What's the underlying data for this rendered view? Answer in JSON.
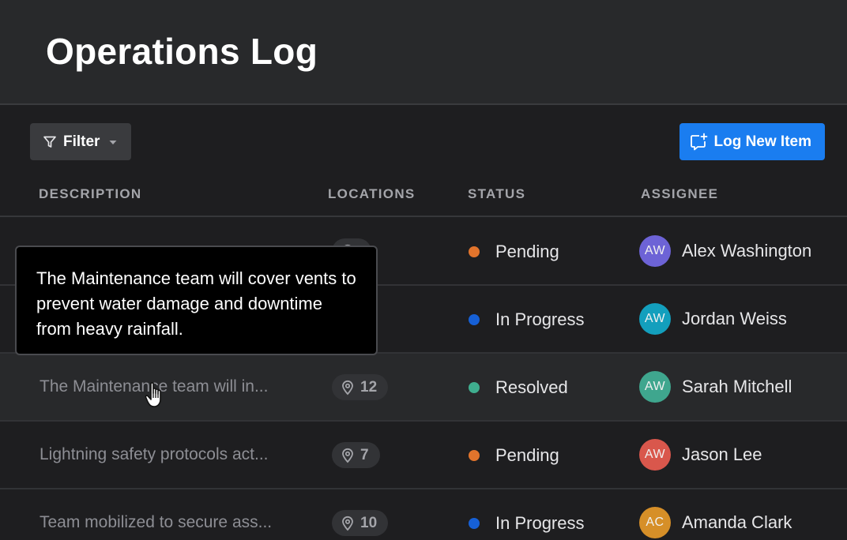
{
  "header": {
    "title": "Operations Log"
  },
  "toolbar": {
    "filter_label": "Filter",
    "log_button_label": "Log New Item"
  },
  "colors": {
    "accent": "#1a7df0",
    "pending": "#e2742c",
    "in_progress": "#1660d6",
    "resolved": "#3fae8f"
  },
  "table": {
    "columns": [
      "DESCRIPTION",
      "LOCATIONS",
      "STATUS",
      "ASSIGNEE"
    ],
    "rows": [
      {
        "description": "",
        "locations": "",
        "status": "Pending",
        "status_color": "#e2742c",
        "initials": "AW",
        "avatar_color": "#6d63d6",
        "assignee": "Alex Washington"
      },
      {
        "description": "",
        "locations": "",
        "status": "In Progress",
        "status_color": "#1660d6",
        "initials": "AW",
        "avatar_color": "#139fbd",
        "assignee": "Jordan Weiss"
      },
      {
        "description": "The Maintenance team will in...",
        "locations": "12",
        "status": "Resolved",
        "status_color": "#3fae8f",
        "initials": "AW",
        "avatar_color": "#3fa68e",
        "assignee": "Sarah Mitchell"
      },
      {
        "description": "Lightning safety protocols act...",
        "locations": "7",
        "status": "Pending",
        "status_color": "#e2742c",
        "initials": "AW",
        "avatar_color": "#d9574c",
        "assignee": "Jason Lee"
      },
      {
        "description": "Team mobilized to secure ass...",
        "locations": "10",
        "status": "In Progress",
        "status_color": "#1660d6",
        "initials": "AC",
        "avatar_color": "#d68f28",
        "assignee": "Amanda Clark"
      }
    ]
  },
  "tooltip": {
    "text": "The Maintenance team will cover vents to prevent water damage and downtime from heavy rainfall."
  },
  "icons": {
    "filter": "filter-funnel-icon",
    "caret": "caret-down-icon",
    "log": "add-comment-icon",
    "location": "map-pin-icon",
    "cursor": "hand-pointer-cursor"
  }
}
